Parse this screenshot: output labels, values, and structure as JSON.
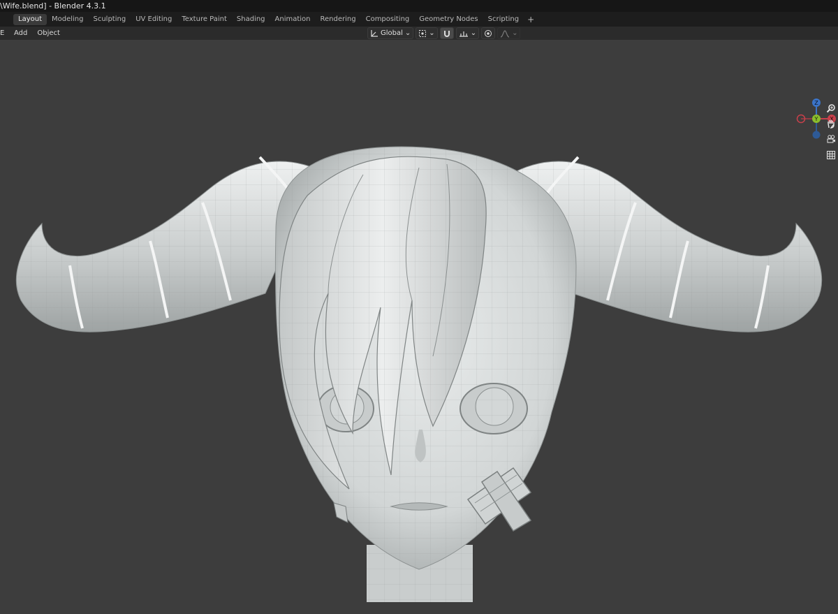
{
  "window": {
    "title": "\\Wife.blend] - Blender 4.3.1"
  },
  "workspace_tabs": [
    {
      "label": "Layout",
      "active": true
    },
    {
      "label": "Modeling",
      "active": false
    },
    {
      "label": "Sculpting",
      "active": false
    },
    {
      "label": "UV Editing",
      "active": false
    },
    {
      "label": "Texture Paint",
      "active": false
    },
    {
      "label": "Shading",
      "active": false
    },
    {
      "label": "Animation",
      "active": false
    },
    {
      "label": "Rendering",
      "active": false
    },
    {
      "label": "Compositing",
      "active": false
    },
    {
      "label": "Geometry Nodes",
      "active": false
    },
    {
      "label": "Scripting",
      "active": false
    }
  ],
  "add_workspace_label": "+",
  "header_menu": {
    "view_partial": "E",
    "add": "Add",
    "object": "Object"
  },
  "transform": {
    "orientation": "Global"
  },
  "gizmo_axes": {
    "z": "Z",
    "y": "Y",
    "x": "X"
  },
  "colors": {
    "x_axis": "#c9404b",
    "y_axis": "#8bbd2c",
    "z_axis": "#3b74c8",
    "viewport_bg": "#3d3d3d",
    "mesh": "#d8dcdc"
  },
  "icons": [
    "transform-pivot-icon",
    "snap-icon",
    "proportional-edit-icon",
    "zoom-icon",
    "hand-pan-icon",
    "camera-icon",
    "grid-icon"
  ]
}
